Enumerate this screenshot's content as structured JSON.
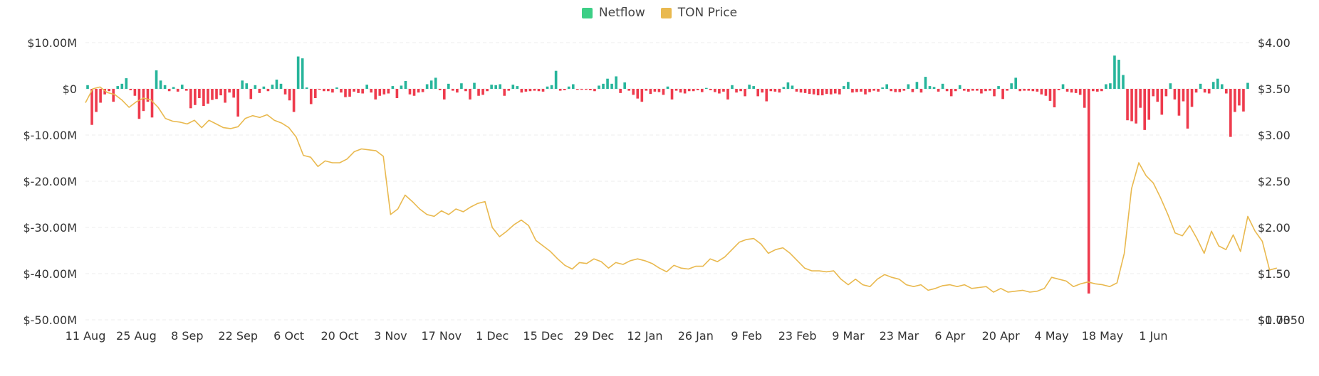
{
  "colors": {
    "inflow": "#27b59b",
    "outflow": "#ee3b4d",
    "price": "#e9b94f",
    "grid": "#eeeeee",
    "legend_netflow": "#3ccf86",
    "legend_price": "#e9b94f"
  },
  "chart_data": {
    "type": "bar+line",
    "legend": [
      {
        "name": "Netflow",
        "color": "#3ccf86"
      },
      {
        "name": "TON Price",
        "color": "#e9b94f"
      }
    ],
    "legend_placement": "top-center",
    "grid": true,
    "left_axis": {
      "ticks": [
        "$10.00M",
        "$0",
        "$-10.00M",
        "$-20.00M",
        "$-30.00M",
        "$-40.00M",
        "$-50.00M"
      ],
      "tick_values": [
        10,
        0,
        -10,
        -20,
        -30,
        -40,
        -50
      ],
      "range": [
        -50,
        10
      ],
      "unit": "M USD"
    },
    "right_axis": {
      "ticks": [
        "$4.00",
        "$3.50",
        "$3.00",
        "$2.50",
        "$2.00",
        "$1.50",
        "$1.00",
        "$0.7350"
      ],
      "tick_values": [
        4.0,
        3.5,
        3.0,
        2.5,
        2.0,
        1.5,
        1.0,
        0.735
      ],
      "range": [
        0.735,
        4.0
      ]
    },
    "x_axis": {
      "labels": [
        "11 Aug",
        "25 Aug",
        "8 Sep",
        "22 Sep",
        "6 Oct",
        "20 Oct",
        "3 Nov",
        "17 Nov",
        "1 Dec",
        "15 Dec",
        "29 Dec",
        "12 Jan",
        "26 Jan",
        "9 Feb",
        "23 Feb",
        "9 Mar",
        "23 Mar",
        "6 Apr",
        "20 Apr",
        "4 May",
        "18 May",
        "1 Jun"
      ],
      "interval_days": 14,
      "range_days": [
        0,
        300
      ]
    },
    "series": [
      {
        "name": "Netflow",
        "type": "bar",
        "unit": "M USD",
        "values": [
          0.8,
          -7.8,
          -5.0,
          -3.0,
          -1.2,
          -0.5,
          -2.8,
          0.6,
          1.1,
          2.3,
          -0.3,
          -1.5,
          -6.5,
          -4.8,
          -2.8,
          -6.2,
          4.0,
          1.8,
          0.8,
          -0.5,
          0.4,
          -0.6,
          0.9,
          -0.4,
          -4.2,
          -3.5,
          -2.0,
          -3.7,
          -3.2,
          -2.4,
          -2.2,
          -1.4,
          -3.0,
          -0.8,
          -1.9,
          -6.0,
          1.8,
          1.2,
          -2.2,
          0.8,
          -0.9,
          0.5,
          -0.5,
          0.9,
          2.0,
          1.1,
          -1.2,
          -2.5,
          -5.0,
          7.0,
          6.6,
          0.3,
          -3.3,
          -2.0,
          -0.2,
          -0.5,
          -0.5,
          -0.8,
          0.3,
          -0.8,
          -1.8,
          -1.7,
          -0.6,
          -0.9,
          -1.0,
          0.9,
          -0.8,
          -2.3,
          -1.5,
          -1.2,
          -1.0,
          0.6,
          -2.0,
          0.7,
          1.7,
          -1.2,
          -1.5,
          -0.8,
          -0.7,
          1.0,
          1.8,
          2.4,
          -0.3,
          -2.3,
          1.1,
          -0.4,
          -0.8,
          1.2,
          -0.5,
          -2.3,
          1.3,
          -1.5,
          -1.3,
          -0.5,
          0.9,
          0.8,
          1.0,
          -1.5,
          -0.4,
          0.9,
          0.6,
          -0.8,
          -0.6,
          -0.5,
          -0.4,
          -0.5,
          -0.6,
          0.5,
          0.8,
          3.9,
          -0.4,
          -0.3,
          0.5,
          1.0,
          -0.2,
          -0.2,
          -0.2,
          -0.3,
          -0.5,
          0.7,
          1.1,
          2.2,
          1.1,
          2.7,
          -0.9,
          1.4,
          -0.4,
          -1.3,
          -2.1,
          -2.8,
          -0.4,
          -1.1,
          -0.6,
          -0.7,
          -1.3,
          0.5,
          -2.3,
          -0.4,
          -0.8,
          -1.0,
          -0.5,
          -0.5,
          -0.3,
          -0.7,
          0.2,
          -0.3,
          -0.7,
          -1.0,
          -0.6,
          -2.3,
          0.8,
          -0.8,
          -0.5,
          -1.6,
          0.9,
          0.6,
          -1.6,
          -0.8,
          -2.7,
          -0.5,
          -0.6,
          -0.8,
          0.4,
          1.4,
          0.7,
          -0.6,
          -0.8,
          -0.9,
          -1.1,
          -1.2,
          -1.4,
          -1.4,
          -1.1,
          -1.2,
          -1.0,
          -1.2,
          0.6,
          1.5,
          -0.8,
          -0.7,
          -0.6,
          -1.2,
          -0.7,
          -0.4,
          -0.6,
          0.3,
          1.0,
          -0.5,
          -0.7,
          -0.7,
          -0.4,
          1.0,
          -0.7,
          1.5,
          -0.8,
          2.6,
          0.6,
          0.4,
          -0.6,
          1.1,
          -0.5,
          -1.6,
          -0.5,
          0.8,
          -0.4,
          -0.6,
          -0.4,
          -0.4,
          -1.0,
          -0.5,
          -0.4,
          -1.6,
          0.6,
          -2.2,
          -0.4,
          1.2,
          2.4,
          -0.5,
          -0.4,
          -0.4,
          -0.5,
          -0.6,
          -1.2,
          -1.5,
          -2.6,
          -4.0,
          -0.3,
          1.0,
          -0.6,
          -0.8,
          -0.9,
          -1.3,
          -4.1,
          -44.3,
          -0.5,
          -0.6,
          -0.5,
          1.0,
          1.2,
          7.2,
          6.3,
          3.0,
          -6.8,
          -7.0,
          -7.5,
          -4.1,
          -8.9,
          -6.7,
          -1.6,
          -2.8,
          -5.6,
          -1.6,
          1.2,
          -2.3,
          -5.8,
          -2.7,
          -8.6,
          -3.9,
          -0.8,
          1.1,
          -0.8,
          -1.0,
          1.5,
          2.2,
          1.0,
          -1.0,
          -10.4,
          -5.0,
          -3.6,
          -4.9,
          1.3
        ]
      },
      {
        "name": "TON Price",
        "type": "line",
        "unit": "USD",
        "points": [
          [
            0,
            3.35
          ],
          [
            2,
            3.5
          ],
          [
            4,
            3.52
          ],
          [
            6,
            3.46
          ],
          [
            8,
            3.44
          ],
          [
            10,
            3.38
          ],
          [
            12,
            3.3
          ],
          [
            14,
            3.36
          ],
          [
            16,
            3.4
          ],
          [
            18,
            3.38
          ],
          [
            20,
            3.3
          ],
          [
            22,
            3.18
          ],
          [
            24,
            3.15
          ],
          [
            26,
            3.14
          ],
          [
            28,
            3.12
          ],
          [
            30,
            3.16
          ],
          [
            32,
            3.08
          ],
          [
            34,
            3.16
          ],
          [
            36,
            3.12
          ],
          [
            38,
            3.08
          ],
          [
            40,
            3.07
          ],
          [
            42,
            3.09
          ],
          [
            44,
            3.18
          ],
          [
            46,
            3.21
          ],
          [
            48,
            3.19
          ],
          [
            50,
            3.22
          ],
          [
            52,
            3.16
          ],
          [
            54,
            3.13
          ],
          [
            56,
            3.08
          ],
          [
            58,
            2.98
          ],
          [
            60,
            2.78
          ],
          [
            62,
            2.76
          ],
          [
            64,
            2.66
          ],
          [
            66,
            2.72
          ],
          [
            68,
            2.7
          ],
          [
            70,
            2.7
          ],
          [
            72,
            2.74
          ],
          [
            74,
            2.82
          ],
          [
            76,
            2.85
          ],
          [
            78,
            2.84
          ],
          [
            80,
            2.83
          ],
          [
            82,
            2.77
          ],
          [
            84,
            2.14
          ],
          [
            86,
            2.2
          ],
          [
            88,
            2.35
          ],
          [
            90,
            2.28
          ],
          [
            92,
            2.2
          ],
          [
            94,
            2.14
          ],
          [
            96,
            2.12
          ],
          [
            98,
            2.18
          ],
          [
            100,
            2.14
          ],
          [
            102,
            2.2
          ],
          [
            104,
            2.17
          ],
          [
            106,
            2.22
          ],
          [
            108,
            2.26
          ],
          [
            110,
            2.28
          ],
          [
            112,
            2.0
          ],
          [
            114,
            1.9
          ],
          [
            116,
            1.96
          ],
          [
            118,
            2.03
          ],
          [
            120,
            2.08
          ],
          [
            122,
            2.02
          ],
          [
            124,
            1.86
          ],
          [
            126,
            1.8
          ],
          [
            128,
            1.74
          ],
          [
            130,
            1.66
          ],
          [
            132,
            1.59
          ],
          [
            134,
            1.55
          ],
          [
            136,
            1.62
          ],
          [
            138,
            1.61
          ],
          [
            140,
            1.66
          ],
          [
            142,
            1.63
          ],
          [
            144,
            1.56
          ],
          [
            146,
            1.62
          ],
          [
            148,
            1.6
          ],
          [
            150,
            1.64
          ],
          [
            152,
            1.66
          ],
          [
            154,
            1.64
          ],
          [
            156,
            1.61
          ],
          [
            158,
            1.56
          ],
          [
            160,
            1.52
          ],
          [
            162,
            1.59
          ],
          [
            164,
            1.56
          ],
          [
            166,
            1.55
          ],
          [
            168,
            1.58
          ],
          [
            170,
            1.58
          ],
          [
            172,
            1.66
          ],
          [
            174,
            1.63
          ],
          [
            176,
            1.68
          ],
          [
            178,
            1.76
          ],
          [
            180,
            1.84
          ],
          [
            182,
            1.87
          ],
          [
            184,
            1.88
          ],
          [
            186,
            1.82
          ],
          [
            188,
            1.72
          ],
          [
            190,
            1.76
          ],
          [
            192,
            1.78
          ],
          [
            194,
            1.72
          ],
          [
            196,
            1.64
          ],
          [
            198,
            1.56
          ],
          [
            200,
            1.53
          ],
          [
            202,
            1.53
          ],
          [
            204,
            1.52
          ],
          [
            206,
            1.53
          ],
          [
            208,
            1.44
          ],
          [
            210,
            1.38
          ],
          [
            212,
            1.44
          ],
          [
            214,
            1.38
          ],
          [
            216,
            1.36
          ],
          [
            218,
            1.44
          ],
          [
            220,
            1.49
          ],
          [
            222,
            1.46
          ],
          [
            224,
            1.44
          ],
          [
            226,
            1.38
          ],
          [
            228,
            1.36
          ],
          [
            230,
            1.38
          ],
          [
            232,
            1.32
          ],
          [
            234,
            1.34
          ],
          [
            236,
            1.37
          ],
          [
            238,
            1.38
          ],
          [
            240,
            1.36
          ],
          [
            242,
            1.38
          ],
          [
            244,
            1.34
          ],
          [
            246,
            1.35
          ],
          [
            248,
            1.36
          ],
          [
            250,
            1.3
          ],
          [
            252,
            1.34
          ],
          [
            254,
            1.3
          ],
          [
            256,
            1.31
          ],
          [
            258,
            1.32
          ],
          [
            260,
            1.3
          ],
          [
            262,
            1.31
          ],
          [
            264,
            1.34
          ],
          [
            266,
            1.46
          ],
          [
            268,
            1.44
          ],
          [
            270,
            1.42
          ],
          [
            272,
            1.36
          ],
          [
            274,
            1.39
          ],
          [
            276,
            1.41
          ],
          [
            278,
            1.39
          ],
          [
            280,
            1.38
          ],
          [
            282,
            1.36
          ],
          [
            284,
            1.4
          ],
          [
            286,
            1.72
          ],
          [
            288,
            2.42
          ],
          [
            290,
            2.7
          ],
          [
            292,
            2.56
          ],
          [
            294,
            2.48
          ],
          [
            296,
            2.32
          ],
          [
            298,
            2.14
          ],
          [
            300,
            1.94
          ],
          [
            302,
            1.91
          ],
          [
            304,
            2.02
          ],
          [
            306,
            1.88
          ],
          [
            308,
            1.72
          ],
          [
            310,
            1.96
          ],
          [
            312,
            1.8
          ],
          [
            314,
            1.76
          ],
          [
            316,
            1.92
          ],
          [
            318,
            1.74
          ],
          [
            320,
            2.12
          ],
          [
            322,
            1.96
          ],
          [
            324,
            1.85
          ],
          [
            326,
            1.54
          ],
          [
            328,
            1.56
          ]
        ]
      }
    ]
  }
}
